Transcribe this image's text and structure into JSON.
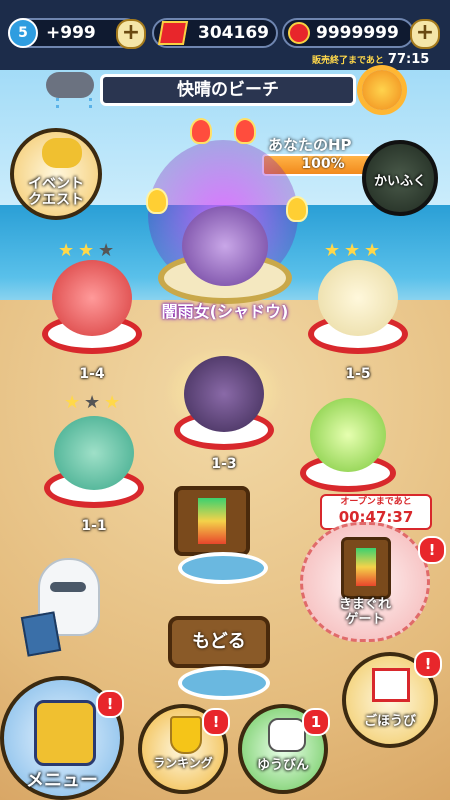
{
  "topbar": {
    "level": "5",
    "stamina": "+999",
    "coins": "304169",
    "points": "9999999",
    "sale_label": "販売終了まであと",
    "sale_timer": "77:15"
  },
  "location": {
    "title": "快晴のビーチ"
  },
  "hp_panel": {
    "label": "あなたのHP",
    "value": "100%",
    "progress": 1.0,
    "heal_label": "かいふく"
  },
  "event_button": {
    "label": "イベント\nクエスト"
  },
  "boss": {
    "name": "闇雨女(シャドウ)"
  },
  "stages": [
    {
      "id": "1-4",
      "stars": 2
    },
    {
      "id": "1-5",
      "stars": 3
    },
    {
      "id": "1-3",
      "stars": 0
    },
    {
      "id": "1-1",
      "stars": 2
    }
  ],
  "gate": {
    "open_label": "オープンまであと",
    "timer": "00:47:37",
    "label": "きまぐれ\nゲート",
    "badge": "!"
  },
  "back_button": {
    "label": "もどる"
  },
  "menu_button": {
    "label": "メニュー",
    "badge": "!"
  },
  "ranking_button": {
    "label": "ランキング",
    "badge": "!"
  },
  "mail_button": {
    "label": "ゆうびん",
    "badge": "1"
  },
  "reward_button": {
    "label": "ごほうび",
    "badge": "!"
  },
  "colors": {
    "accent_red": "#d8282c",
    "topbar": "#1c2c4a",
    "hp_orange": "#f28a1c"
  }
}
